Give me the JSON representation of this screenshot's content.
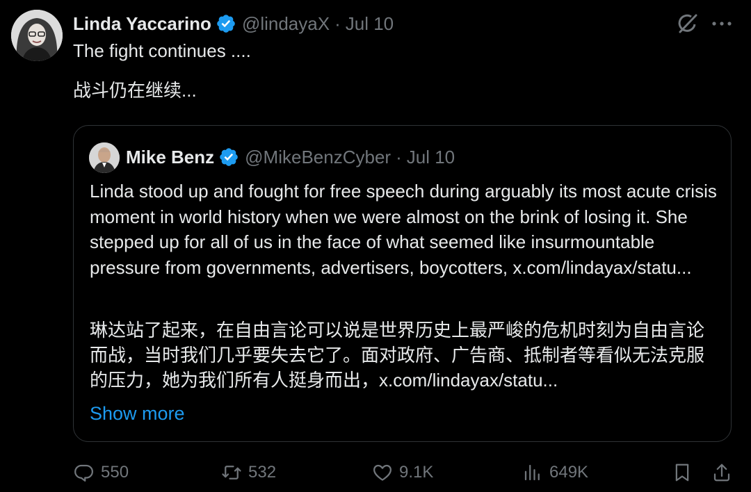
{
  "tweet": {
    "author_name": "Linda Yaccarino",
    "author_handle": "@lindayaX",
    "separator": "·",
    "date": "Jul 10",
    "text_en": "The fight continues ....",
    "text_zh": "战斗仍在继续..."
  },
  "quote": {
    "author_name": "Mike Benz",
    "author_handle": "@MikeBenzCyber",
    "separator": "·",
    "date": "Jul 10",
    "text_en": "Linda stood up and fought for free speech during arguably its most acute crisis moment in world history when we were almost on the brink of losing it. She stepped up for all of us in the face of what seemed like insurmountable pressure from governments, advertisers, boycotters, x.com/lindayax/statu...",
    "text_zh": "琳达站了起来，在自由言论可以说是世界历史上最严峻的危机时刻为自由言论而战，当时我们几乎要失去它了。面对政府、广告商、抵制者等看似无法克服的压力，她为我们所有人挺身而出，x.com/lindayax/statu...",
    "show_more": "Show more"
  },
  "actions": {
    "replies": "550",
    "reposts": "532",
    "likes": "9.1K",
    "views": "649K"
  },
  "colors": {
    "background": "#000000",
    "text": "#e7e9ea",
    "secondary": "#71767b",
    "accent": "#1d9bf0",
    "border": "#2f3336"
  },
  "icons": [
    "verified-badge-icon",
    "grok-icon",
    "more-icon",
    "reply-icon",
    "repost-icon",
    "like-icon",
    "views-icon",
    "bookmark-icon",
    "share-icon"
  ]
}
